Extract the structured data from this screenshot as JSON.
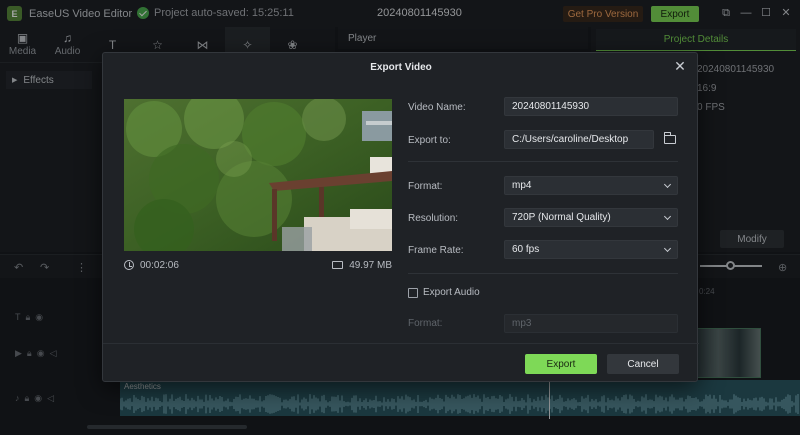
{
  "app": {
    "title": "EaseUS Video Editor",
    "autosave": "Project auto-saved: 15:25:11",
    "project_name": "20240801145930",
    "get_pro_label": "Get Pro Version",
    "export_label": "Export"
  },
  "toolbar": {
    "tools": [
      {
        "label": "Media",
        "icon": "media-icon"
      },
      {
        "label": "Audio",
        "icon": "audio-icon"
      },
      {
        "label": "",
        "icon": "text-icon"
      },
      {
        "label": "",
        "icon": "star-icon"
      },
      {
        "label": "",
        "icon": "transition-icon"
      },
      {
        "label": "",
        "icon": "effects-icon"
      },
      {
        "label": "",
        "icon": "overlay-icon"
      }
    ]
  },
  "left_panel": {
    "effects_label": "Effects"
  },
  "player": {
    "label": "Player"
  },
  "right_panel": {
    "tab": "Project Details",
    "name_partial": "20240801145930",
    "ratio_partial": "16:9",
    "fps_partial": "0 FPS",
    "modify_label": "Modify"
  },
  "timeline": {
    "ruler_partial": "0:24",
    "audio_clip_label": "Aesthetics"
  },
  "dialog": {
    "title": "Export Video",
    "duration": "00:02:06",
    "file_size": "49.97 MB",
    "video_name_label": "Video Name:",
    "video_name_value": "20240801145930",
    "export_to_label": "Export to:",
    "export_to_value": "C:/Users/caroline/Desktop",
    "format_label": "Format:",
    "format_value": "mp4",
    "resolution_label": "Resolution:",
    "resolution_value": "720P (Normal Quality)",
    "frame_rate_label": "Frame Rate:",
    "frame_rate_value": "60 fps",
    "export_audio_label": "Export Audio",
    "audio_format_label": "Format:",
    "audio_format_value": "mp3",
    "export_button": "Export",
    "cancel_button": "Cancel"
  },
  "colors": {
    "accent": "#7ed957",
    "background": "#1a1d21",
    "dialog": "#1f2226",
    "input": "#2b2f34"
  }
}
